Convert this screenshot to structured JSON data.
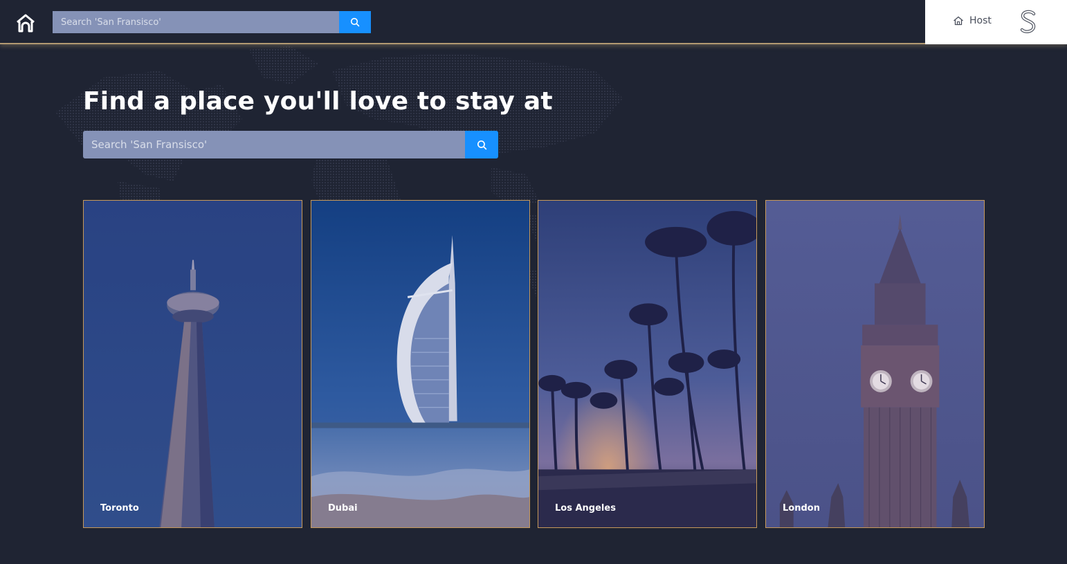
{
  "header": {
    "search_placeholder": "Search 'San Fransisco'",
    "host_label": "Host"
  },
  "hero": {
    "title": "Find a place you'll love to stay at",
    "search_placeholder": "Search 'San Fransisco'"
  },
  "destinations": [
    {
      "name": "Toronto"
    },
    {
      "name": "Dubai"
    },
    {
      "name": "Los Angeles"
    },
    {
      "name": "London"
    }
  ],
  "colors": {
    "background": "#1f2433",
    "accent_blue": "#1790ff",
    "search_field": "#8592b7",
    "card_border": "#c7995a",
    "header_border": "#b39a72"
  },
  "icons": {
    "logo": "house-arch-icon",
    "search": "search-icon",
    "host": "home-outline-icon",
    "avatar": "s-letter-avatar"
  }
}
